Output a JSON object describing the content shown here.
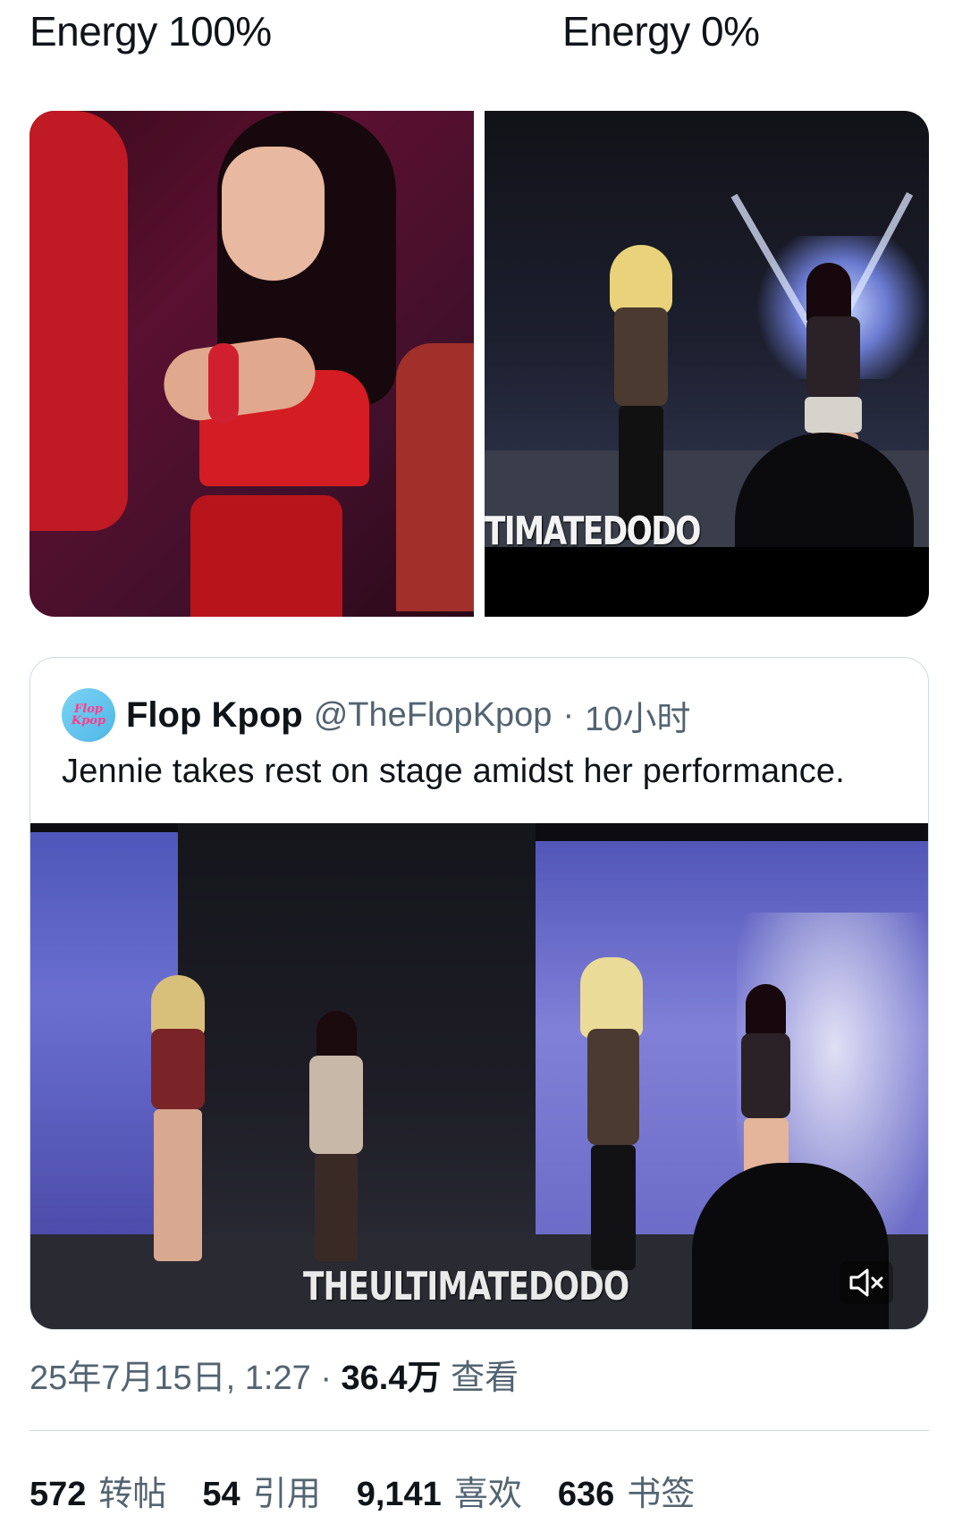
{
  "headers": {
    "left": "Energy 100%",
    "right": "Energy 0%"
  },
  "right_photo": {
    "watermark": "TIMATEDODO"
  },
  "quote": {
    "author_name": "Flop Kpop",
    "author_handle": "@TheFlopKpop",
    "separator": "·",
    "time_ago": "10小时",
    "avatar_text_top": "Flop",
    "avatar_text_bottom": "Kpop",
    "text": "Jennie takes rest on stage amidst her performance.",
    "video_watermark": "THEULTIMATEDODO"
  },
  "meta": {
    "timestamp": "25年7月15日, 1:27",
    "separator": "·",
    "views_count": "36.4万",
    "views_label": "查看"
  },
  "stats": [
    {
      "count": "572",
      "label": "转帖"
    },
    {
      "count": "54",
      "label": "引用"
    },
    {
      "count": "9,141",
      "label": "喜欢"
    },
    {
      "count": "636",
      "label": "书签"
    }
  ],
  "icons": {
    "mute": "speaker-muted-icon"
  },
  "colors": {
    "text_primary": "#0f1419",
    "text_secondary": "#536471",
    "border": "#cfd9de"
  }
}
